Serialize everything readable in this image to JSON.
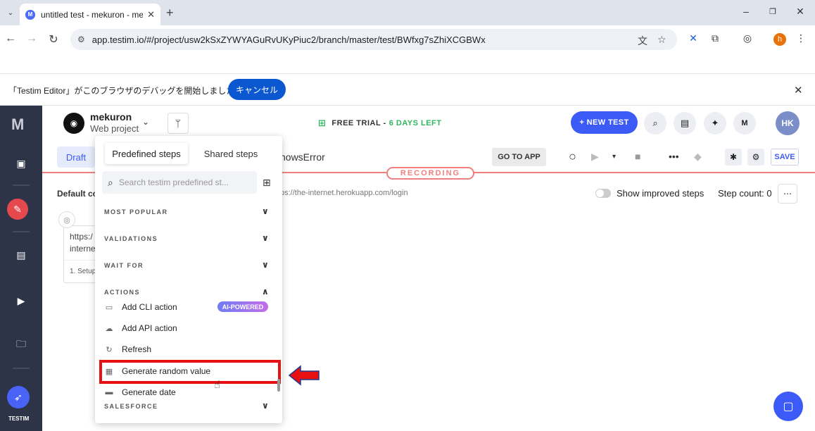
{
  "browser": {
    "tab_title": "untitled test - mekuron - me",
    "favicon_letter": "M",
    "url": "app.testim.io/#/project/usw2kSxZYWYAGuRvUKyPiuc2/branch/master/test/BWfxg7sZhiXCGBWx",
    "profile_letter": "h"
  },
  "infobar": {
    "message": "「Testim Editor」がこのブラウザのデバッグを開始しました",
    "cancel_label": "キャンセル"
  },
  "sidebar": {
    "logo": "M",
    "brand": "TESTIM"
  },
  "header": {
    "project_name": "mekuron",
    "project_type": "Web project",
    "trial_label": "FREE TRIAL -",
    "trial_days": "6 DAYS LEFT",
    "new_test_label": "+ NEW TEST",
    "avatar_initials": "HK"
  },
  "toolbar": {
    "draft_label": "Draft",
    "test_name_fragment": "howsError",
    "goto_app_label": "GO TO APP",
    "save_label": "SAVE",
    "recording_label": "RECORDING"
  },
  "content": {
    "default_config": "Default cor",
    "url_fragment": "ps://the-internet.herokuapp.com/login",
    "improved_steps_label": "Show improved steps",
    "step_count_label": "Step count: 0",
    "step_card_line1": "https:/",
    "step_card_line2": "interne",
    "step_card_footer": "1. Setup"
  },
  "panel": {
    "tab_predefined": "Predefined steps",
    "tab_shared": "Shared steps",
    "search_placeholder": "Search testim predefined st...",
    "sections": [
      "MOST POPULAR",
      "VALIDATIONS",
      "WAIT FOR",
      "ACTIONS",
      "SALESFORCE"
    ],
    "actions": [
      {
        "label": "Add CLI action",
        "icon": "cli-icon"
      },
      {
        "label": "Add API action",
        "icon": "cloud-icon"
      },
      {
        "label": "Refresh",
        "icon": "refresh-icon"
      },
      {
        "label": "Generate random value",
        "icon": "random-value-icon"
      },
      {
        "label": "Generate date",
        "icon": "date-icon"
      }
    ],
    "ai_badge": "AI-POWERED"
  },
  "colors": {
    "accent": "#3c5bf6",
    "recording": "#f08080",
    "highlight": "#e81010",
    "sidebar_bg": "#2e3448",
    "trial_green": "#2fb65e"
  }
}
